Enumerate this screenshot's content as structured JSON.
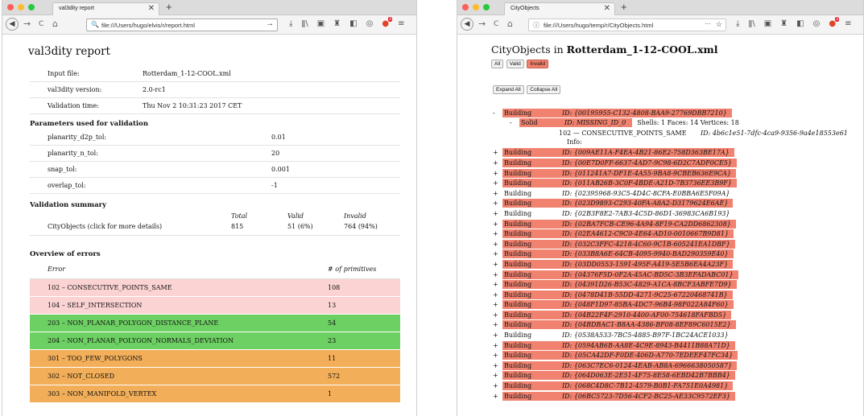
{
  "left_window": {
    "tab_title": "val3dity report",
    "url": "file:///Users/hugo/elvis/r/report.html",
    "report": {
      "title": "val3dity report",
      "info": [
        {
          "key": "Input file:",
          "value": "Rotterdam_1-12-COOL.xml"
        },
        {
          "key": "val3dity version:",
          "value": "2.0-rc1"
        },
        {
          "key": "Validation time:",
          "value": "Thu Nov 2 10:31:23 2017 CET"
        }
      ],
      "params_heading": "Parameters used for validation",
      "params": [
        {
          "key": "planarity_d2p_tol:",
          "value": "0.01"
        },
        {
          "key": "planarity_n_tol:",
          "value": "20"
        },
        {
          "key": "snap_tol:",
          "value": "0.001"
        },
        {
          "key": "overlap_tol:",
          "value": "-1"
        }
      ],
      "summary_heading": "Validation summary",
      "summary_cols": [
        "Total",
        "Valid",
        "Invalid"
      ],
      "summary_row": {
        "label": "CityObjects (click for more details)",
        "total": "815",
        "valid": "51 (6%)",
        "invalid": "764 (94%)"
      },
      "errors_heading": "Overview of errors",
      "errors_cols": [
        "Error",
        "# of primitives"
      ],
      "errors": [
        {
          "label": "102 – CONSECUTIVE_POINTS_SAME",
          "count": "108",
          "color": "#fcd3d3"
        },
        {
          "label": "104 – SELF_INTERSECTION",
          "count": "13",
          "color": "#fcd3d3"
        },
        {
          "label": "203 – NON_PLANAR_POLYGON_DISTANCE_PLANE",
          "count": "54",
          "color": "#6dd063"
        },
        {
          "label": "204 – NON_PLANAR_POLYGON_NORMALS_DEVIATION",
          "count": "23",
          "color": "#6dd063"
        },
        {
          "label": "301 – TOO_FEW_POLYGONS",
          "count": "11",
          "color": "#f2ae58"
        },
        {
          "label": "302 – NOT_CLOSED",
          "count": "572",
          "color": "#f2ae58"
        },
        {
          "label": "303 – NON_MANIFOLD_VERTEX",
          "count": "1",
          "color": "#f2ae58"
        }
      ]
    }
  },
  "right_window": {
    "tab_title": "CityObjects",
    "url": "file:///Users/hugo/temp/r/CityObjects.html",
    "url_more": "···",
    "page": {
      "title_prefix": "CityObjects in ",
      "title_file": "Rotterdam_1-12-COOL.xml",
      "filter_all": "All",
      "filter_valid": "Valid",
      "filter_invalid": "Invalid",
      "expand_all": "Expand All",
      "collapse_all": "Collapse All",
      "first_object": {
        "sign": "-",
        "type": "Building",
        "id": "ID: {00195955-C132-4808-BAA9-27769DBB7210}",
        "solid": {
          "sign": "-",
          "type": "Solid",
          "id": "ID: MISSING_ID_0",
          "info": "Shells: 1    Faces: 14    Vertices: 18"
        },
        "error_code": "102 — CONSECUTIVE_POINTS_SAME",
        "error_id": "ID: 4b6c1e51-7dfc-4ca9-9356-9a4e18553e61",
        "info_label": "Info:"
      },
      "objects": [
        {
          "sign": "+",
          "type": "Building",
          "id": "ID: {009AE11A-F4EA-4B21-86E2-758D363BE17A}",
          "invalid": true
        },
        {
          "sign": "+",
          "type": "Building",
          "id": "ID: {00E7D0FF-6637-4AD7-9C98-6D2C7ADF0CE5}",
          "invalid": true
        },
        {
          "sign": "+",
          "type": "Building",
          "id": "ID: {011241A7-DF1E-4A55-9BA8-9CBEB636E9CA}",
          "invalid": true
        },
        {
          "sign": "+",
          "type": "Building",
          "id": "ID: {011AB26B-3C0F-4BDE-A21D-7B3736EE3B9F}",
          "invalid": true
        },
        {
          "sign": "+",
          "type": "Building",
          "id": "ID: {02395968-93C5-4D4C-8CFA-E0BBA6E5F09A}",
          "invalid": false
        },
        {
          "sign": "+",
          "type": "Building",
          "id": "ID: {023D9893-C293-40FA-A8A2-D3179624E6AE}",
          "invalid": true
        },
        {
          "sign": "+",
          "type": "Building",
          "id": "ID: {02B3F8E2-7AB3-4C5D-86D1-36983CA6B193}",
          "invalid": false
        },
        {
          "sign": "+",
          "type": "Building",
          "id": "ID: {02BA7FCB-CE96-4A94-8F19-CA2DD6862308}",
          "invalid": true
        },
        {
          "sign": "+",
          "type": "Building",
          "id": "ID: {02EA4612-C9C0-4E64-AD10-0010667B9D81}",
          "invalid": true
        },
        {
          "sign": "+",
          "type": "Building",
          "id": "ID: {032C3FFC-4218-4C60-9C1B-605241EA1DBF}",
          "invalid": true
        },
        {
          "sign": "+",
          "type": "Building",
          "id": "ID: {033B8A6E-64CB-4095-9940-BAD290359E40}",
          "invalid": true
        },
        {
          "sign": "+",
          "type": "Building",
          "id": "ID: {03DD0553-1591-495F-A419-5E5B6EA4A23F}",
          "invalid": true
        },
        {
          "sign": "+",
          "type": "Building",
          "id": "ID: {04376F5D-0F2A-45AC-BD5C-3B3EFADABC01}",
          "invalid": true
        },
        {
          "sign": "+",
          "type": "Building",
          "id": "ID: {04391D26-B53C-4829-A1CA-8BCF3ABFE7D9}",
          "invalid": true
        },
        {
          "sign": "+",
          "type": "Building",
          "id": "ID: {0478D41B-55DD-4271-9C25-67220468741B}",
          "invalid": true
        },
        {
          "sign": "+",
          "type": "Building",
          "id": "ID: {048F1D97-85BA-4DC7-96B4-98F022A84F60}",
          "invalid": true
        },
        {
          "sign": "+",
          "type": "Building",
          "id": "ID: {04B22F4F-2910-4400-AF00-754618FAFBD5}",
          "invalid": true
        },
        {
          "sign": "+",
          "type": "Building",
          "id": "ID: {04BDBAC1-B8AA-4386-BF08-8EF89C6015E2}",
          "invalid": true
        },
        {
          "sign": "+",
          "type": "Building",
          "id": "ID: {0538A533-7BC5-4885-B97F-1BC24ACE1033}",
          "invalid": false
        },
        {
          "sign": "+",
          "type": "Building",
          "id": "ID: {0594AB6B-AA8E-4C9E-8943-B4411B88A71D}",
          "invalid": true
        },
        {
          "sign": "+",
          "type": "Building",
          "id": "ID: {05CA42DF-F0DE-406D-A770-7EDEEF47FC34}",
          "invalid": true
        },
        {
          "sign": "+",
          "type": "Building",
          "id": "ID: {063C7EC6-0124-4EAB-AB8A-6966638050587}",
          "invalid": true
        },
        {
          "sign": "+",
          "type": "Building",
          "id": "ID: {064D063E-2E51-4F75-8E58-6EBD42B7BBB4}",
          "invalid": true
        },
        {
          "sign": "+",
          "type": "Building",
          "id": "ID: {068C4D8C-7B12-4579-B0B1-FA751E0A4981}",
          "invalid": true
        },
        {
          "sign": "+",
          "type": "Building",
          "id": "ID: {06BC5723-7D56-4CF2-BC25-AE33C9572EF3}",
          "invalid": true
        }
      ]
    }
  },
  "icons": {
    "back": "◀",
    "forward": "→",
    "reload": "C",
    "home": "⌂",
    "search": "🔍",
    "info": "ⓘ",
    "go": "→",
    "star": "☆",
    "download": "⤓",
    "library": "ǁ\\",
    "sidebar": "▣",
    "pocket": "♜",
    "extension": "◧",
    "account": "◎",
    "menu": "≡",
    "addon": "●",
    "addon_badge": "3",
    "close": "✕",
    "newtab": "+"
  },
  "colors": {
    "invalid": "#f0826f"
  }
}
